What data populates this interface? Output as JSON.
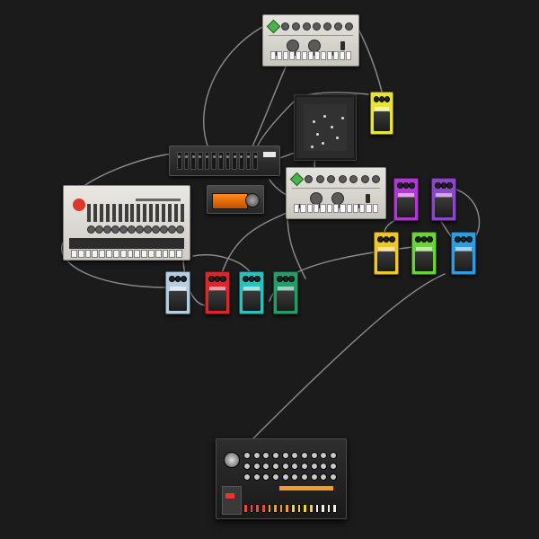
{
  "canvas": {
    "background": "#1b1b1b",
    "cable_color": "#8d8d8d"
  },
  "devices": {
    "bass_synth_1": {
      "kind": "bass-synthesizer",
      "accent": "#47b34a"
    },
    "bass_synth_2": {
      "kind": "bass-synthesizer",
      "accent": "#47b34a"
    },
    "xy_pad": {
      "kind": "xy-pad",
      "dot_count": 8
    },
    "mixer": {
      "kind": "mixer",
      "channels": 12
    },
    "display_unit": {
      "kind": "display-unit",
      "screen_color": "#ff8a1c"
    },
    "drum_machine_909": {
      "kind": "drum-machine",
      "logo_color": "#e0352b"
    },
    "drum_machine_808": {
      "kind": "drum-machine",
      "step_colors": [
        "#e74c3c",
        "#f39c2a",
        "#f4d03f",
        "#f5f0e6"
      ]
    }
  },
  "pedals": [
    {
      "id": "pedal-yellow-top",
      "color": "#e8e23a"
    },
    {
      "id": "pedal-purple-1",
      "color": "#b238d6"
    },
    {
      "id": "pedal-purple-2",
      "color": "#8b46c9"
    },
    {
      "id": "pedal-yellow-2",
      "color": "#f0c52c"
    },
    {
      "id": "pedal-green",
      "color": "#6ad23a"
    },
    {
      "id": "pedal-blue",
      "color": "#2f9be0"
    },
    {
      "id": "pedal-light-blue",
      "color": "#b5cde0"
    },
    {
      "id": "pedal-red",
      "color": "#d9282c"
    },
    {
      "id": "pedal-teal",
      "color": "#2bc0bd"
    },
    {
      "id": "pedal-dark-green",
      "color": "#249c68"
    }
  ]
}
